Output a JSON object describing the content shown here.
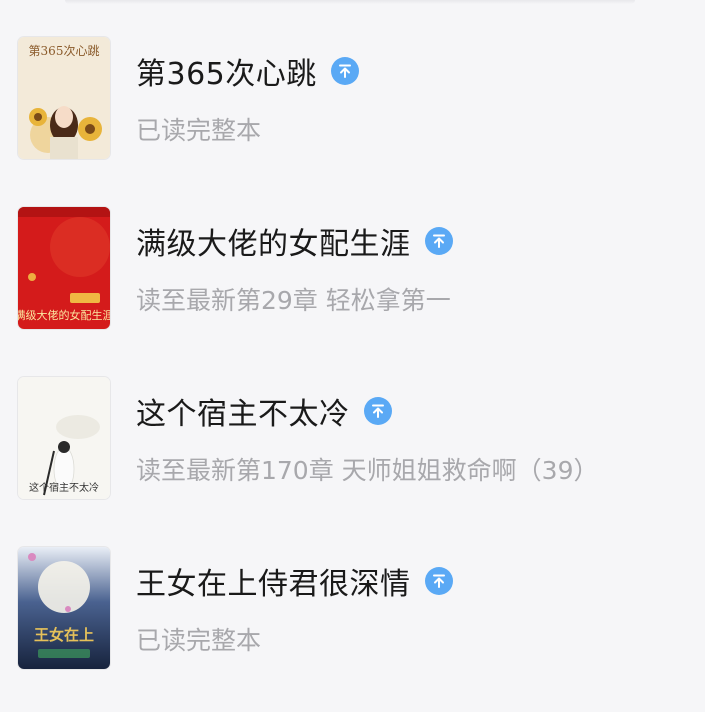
{
  "books": [
    {
      "title": "第365次心跳",
      "status": "已读完整本",
      "pin_icon": "pin-top-icon",
      "cover_text": "第365次心跳",
      "cover_colors": {
        "bg": "#f3ead9",
        "accent": "#e8b43a"
      }
    },
    {
      "title": "满级大佬的女配生涯",
      "status": "读至最新第29章 轻松拿第一",
      "pin_icon": "pin-top-icon",
      "cover_text": "满级大佬的女配生涯",
      "cover_colors": {
        "bg": "#d41b1b",
        "accent": "#f4d24a"
      }
    },
    {
      "title": "这个宿主不太冷",
      "status": "读至最新第170章 天师姐姐救命啊（39）",
      "pin_icon": "pin-top-icon",
      "cover_text": "这个宿主不太冷",
      "cover_colors": {
        "bg": "#f7f6f2",
        "accent": "#333333"
      }
    },
    {
      "title": "王女在上侍君很深情",
      "status": "已读完整本",
      "pin_icon": "pin-top-icon",
      "cover_text": "王女在上",
      "cover_colors": {
        "bg": "#203456",
        "accent": "#e6c15a"
      }
    }
  ]
}
